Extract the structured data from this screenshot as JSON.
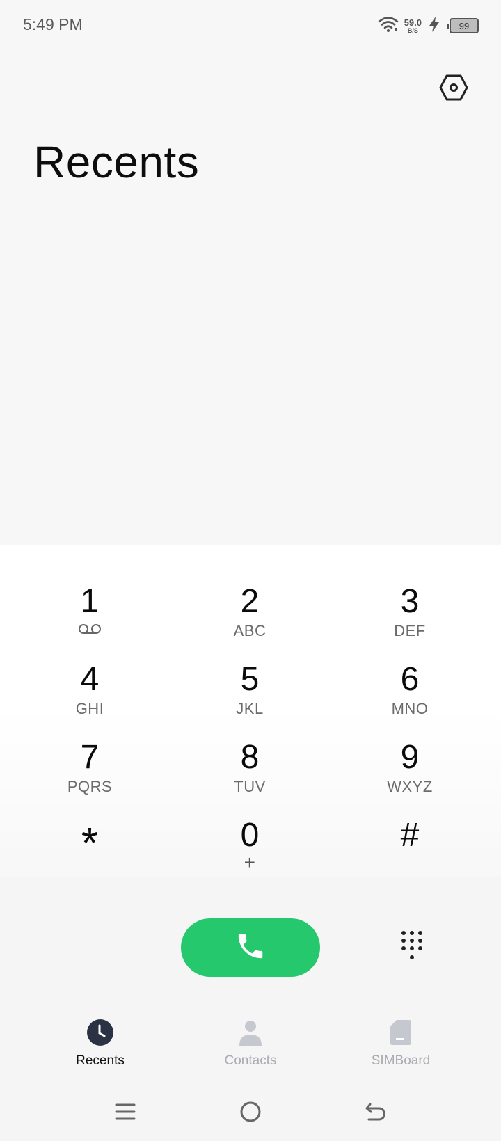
{
  "status_bar": {
    "time": "5:49 PM",
    "net_speed_value": "59.0",
    "net_speed_unit": "B/S",
    "battery_level": "99",
    "icons": [
      "wifi-icon",
      "charging-icon",
      "battery-icon"
    ]
  },
  "header": {
    "title": "Recents",
    "settings_icon": "settings-hexagon-icon"
  },
  "dialpad": {
    "keys": [
      {
        "digit": "1",
        "letters": ""
      },
      {
        "digit": "2",
        "letters": "ABC"
      },
      {
        "digit": "3",
        "letters": "DEF"
      },
      {
        "digit": "4",
        "letters": "GHI"
      },
      {
        "digit": "5",
        "letters": "JKL"
      },
      {
        "digit": "6",
        "letters": "MNO"
      },
      {
        "digit": "7",
        "letters": "PQRS"
      },
      {
        "digit": "8",
        "letters": "TUV"
      },
      {
        "digit": "9",
        "letters": "WXYZ"
      },
      {
        "digit": "*",
        "letters": ""
      },
      {
        "digit": "0",
        "letters": "+"
      },
      {
        "digit": "#",
        "letters": ""
      }
    ],
    "key1_icon": "voicemail-icon",
    "call_icon": "phone-icon",
    "call_color": "#26c86d",
    "toggle_icon": "dialpad-grid-icon"
  },
  "tabs": [
    {
      "label": "Recents",
      "icon": "clock-icon",
      "active": true
    },
    {
      "label": "Contacts",
      "icon": "person-icon",
      "active": false
    },
    {
      "label": "SIMBoard",
      "icon": "sim-card-icon",
      "active": false
    }
  ],
  "nav_bar": {
    "icons": [
      "menu-icon",
      "home-icon",
      "back-icon"
    ]
  }
}
